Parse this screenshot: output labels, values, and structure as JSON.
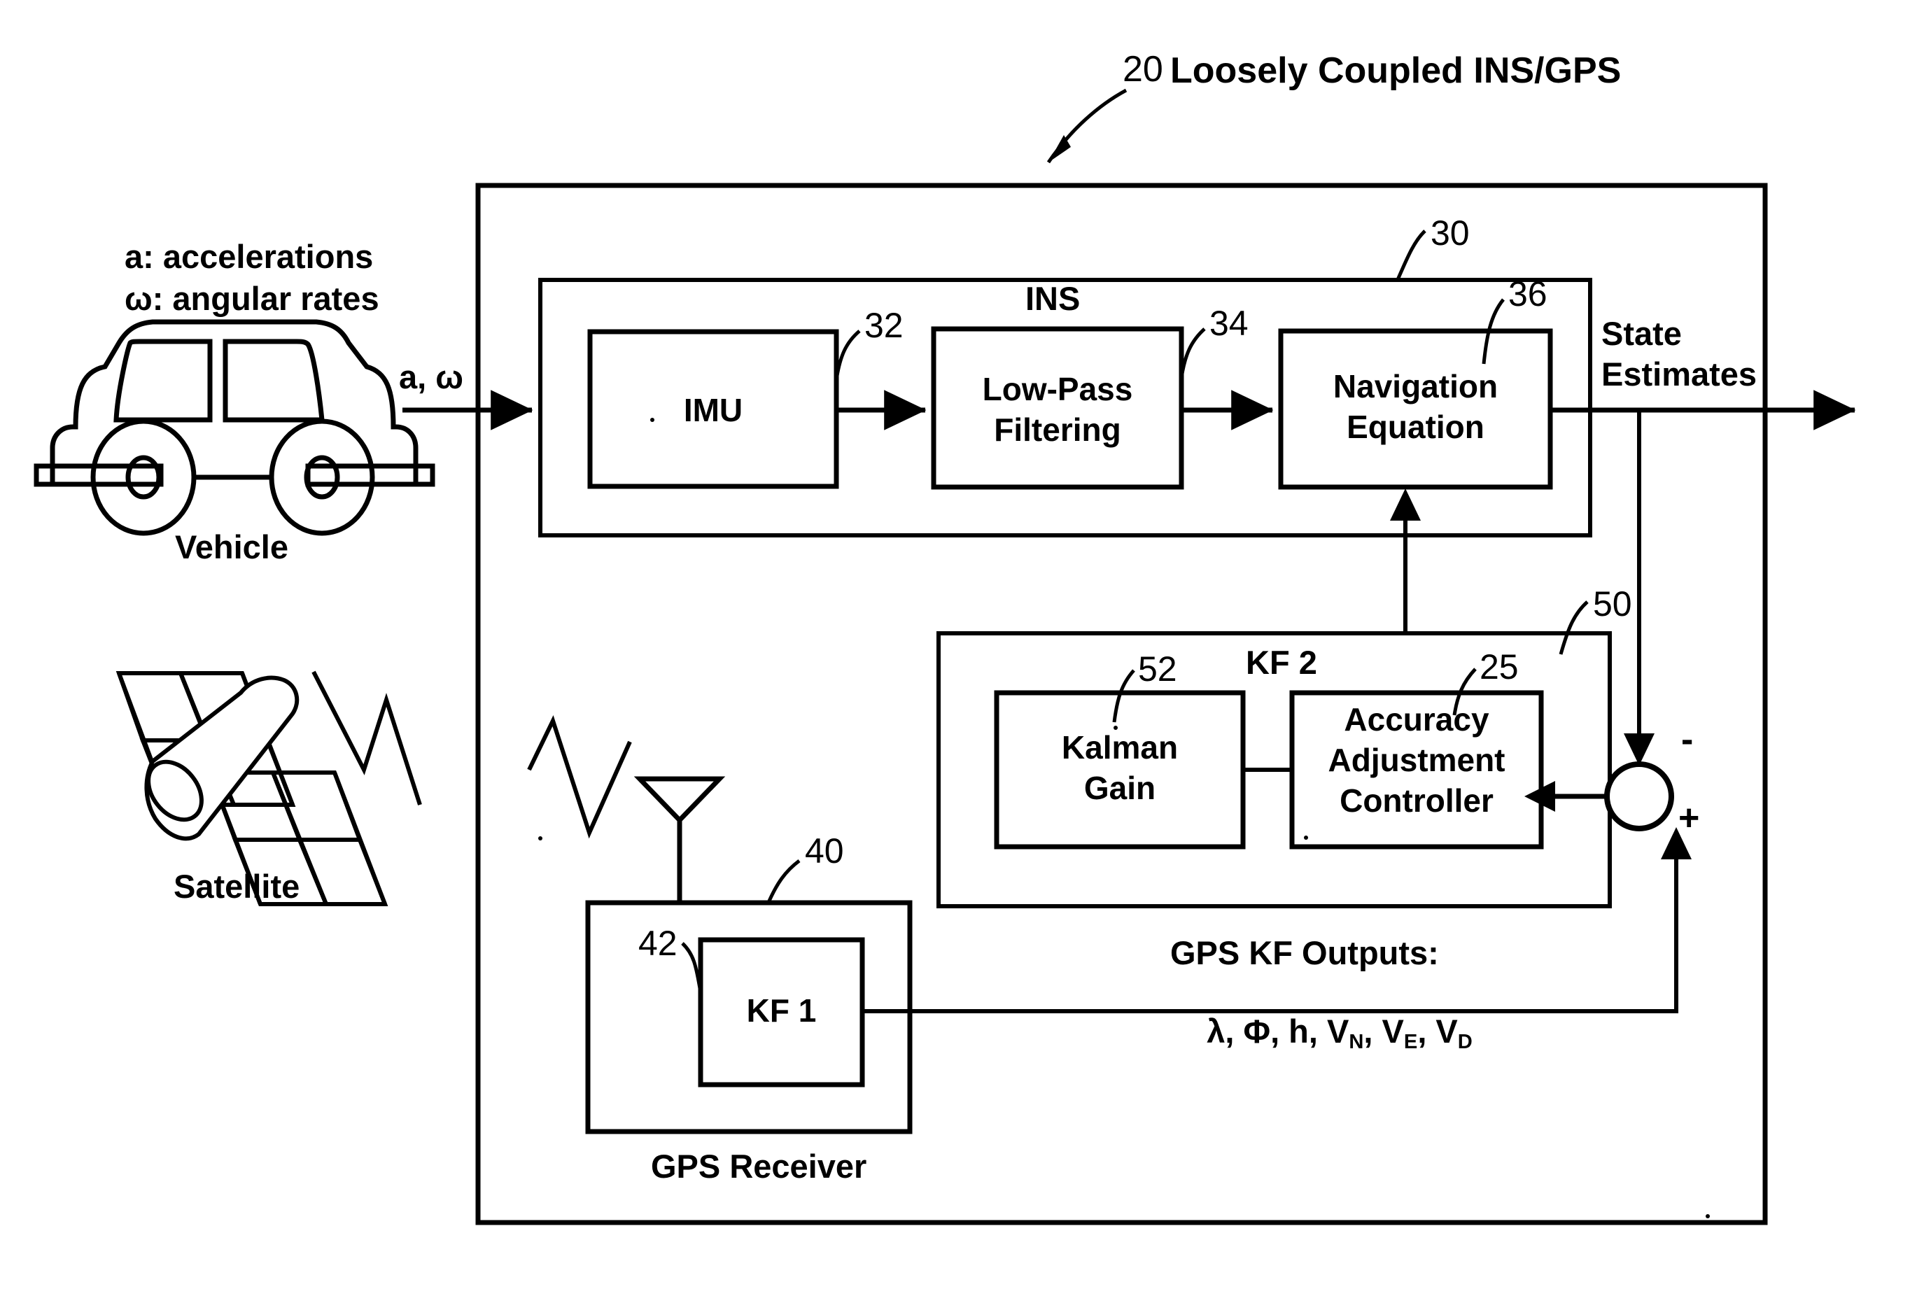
{
  "figure": {
    "title": "Loosely Coupled INS/GPS",
    "title_ref": "20"
  },
  "left_panel": {
    "legend_line1": "a: accelerations",
    "legend_line2": "ω: angular rates",
    "vehicle_label": "Vehicle",
    "satellite_label": "Satellite",
    "vehicle_signal": "a, ω"
  },
  "ins": {
    "label": "INS",
    "ref": "30",
    "blocks": [
      {
        "label": "IMU",
        "ref": "32"
      },
      {
        "label_line1": "Low-Pass",
        "label_line2": "Filtering",
        "ref": "34"
      },
      {
        "label_line1": "Navigation",
        "label_line2": "Equation",
        "ref": "36"
      }
    ]
  },
  "kf2": {
    "label": "KF 2",
    "ref": "50",
    "blocks": [
      {
        "label_line1": "Kalman",
        "label_line2": "Gain",
        "ref": "52"
      },
      {
        "label_line1": "Accuracy",
        "label_line2": "Adjustment",
        "label_line3": "Controller",
        "ref": "25"
      }
    ]
  },
  "gps_receiver": {
    "label": "GPS Receiver",
    "ref": "40",
    "kf1_label": "KF 1",
    "kf1_ref": "42"
  },
  "outputs": {
    "state_estimates_line1": "State",
    "state_estimates_line2": "Estimates",
    "gps_kf_outputs_line1": "GPS KF Outputs:",
    "gps_kf_outputs_prefix": "λ, Φ, h, V",
    "gps_kf_outputs_sub1": "N",
    "gps_kf_outputs_mid1": ", V",
    "gps_kf_outputs_sub2": "E",
    "gps_kf_outputs_mid2": ", V",
    "gps_kf_outputs_sub3": "D"
  },
  "summing_junction": {
    "minus_sign": "-",
    "plus_sign": "+"
  },
  "colors": {
    "line": "#000000",
    "background": "#ffffff"
  }
}
